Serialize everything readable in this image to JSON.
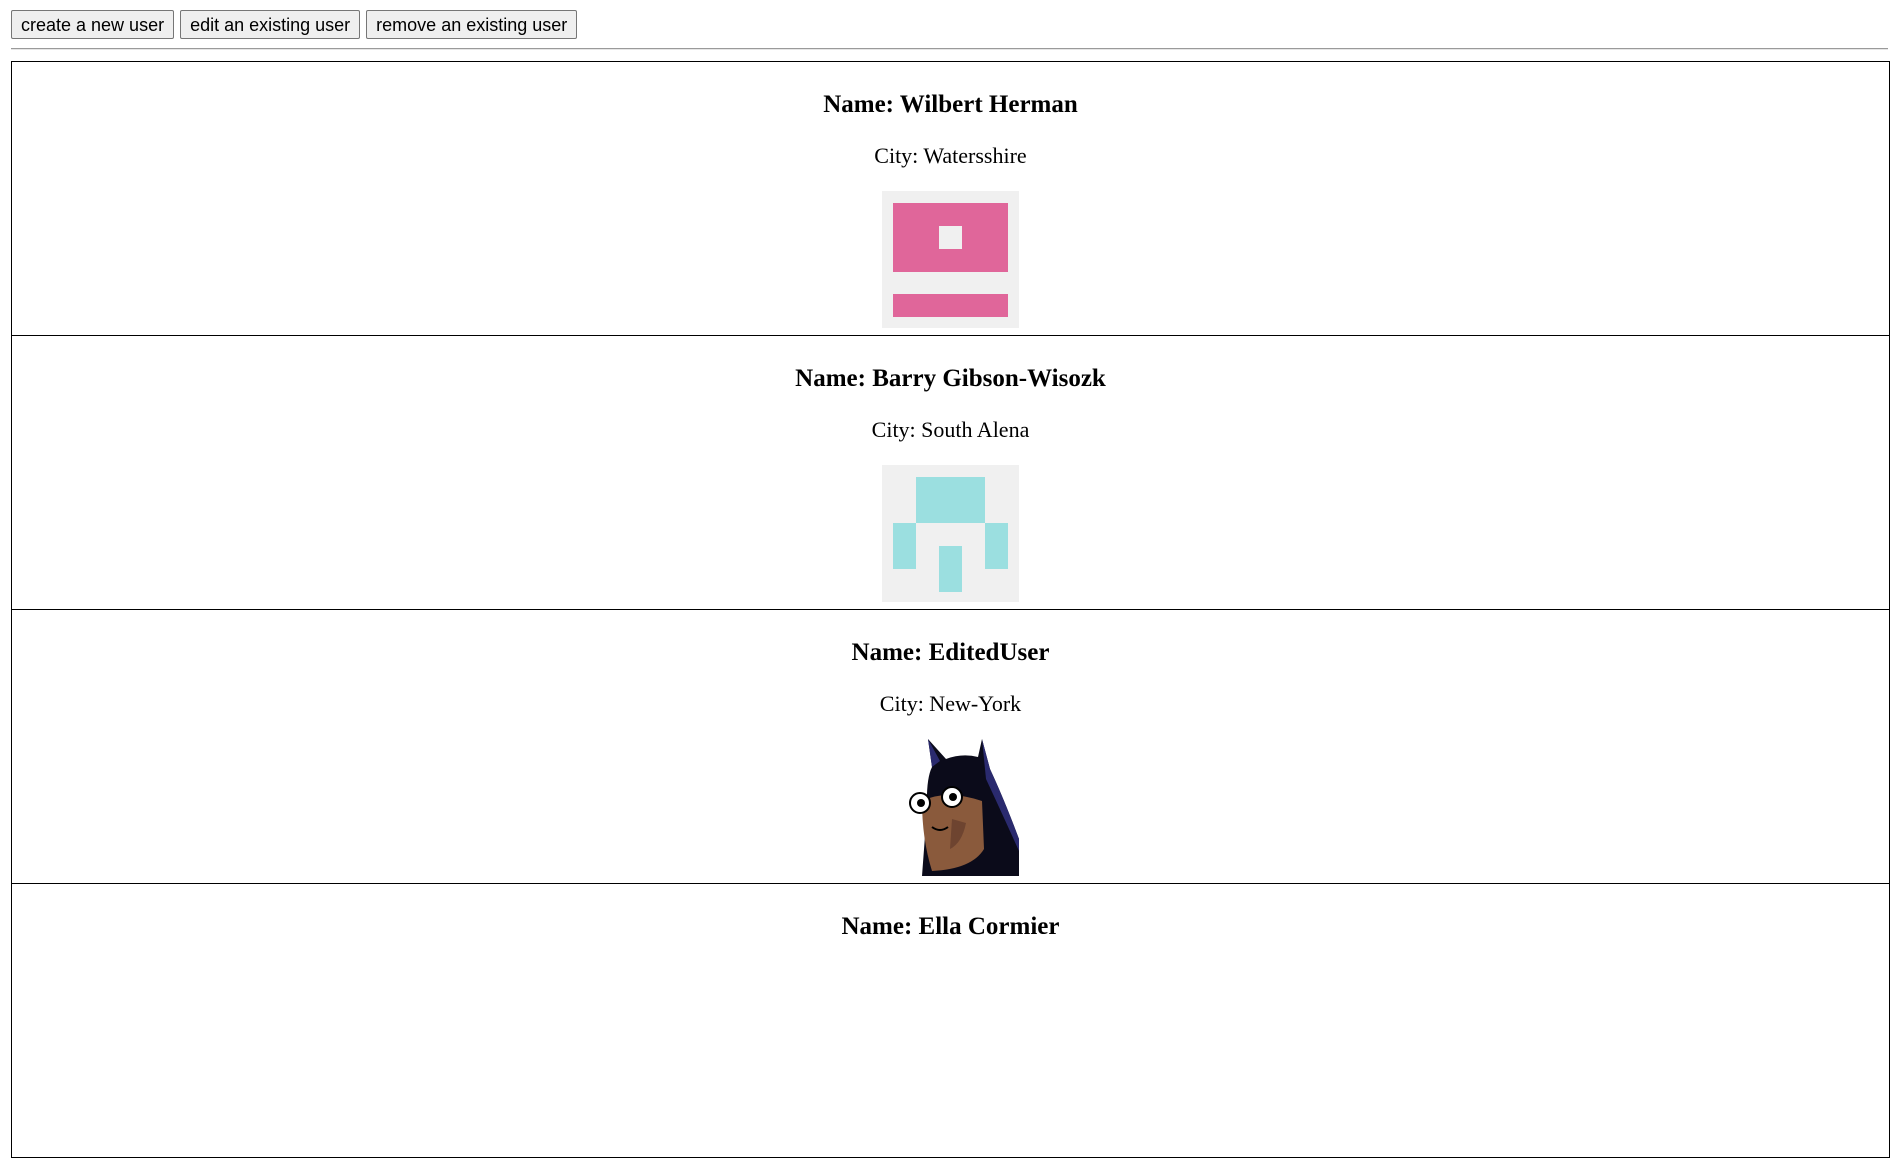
{
  "toolbar": {
    "create_label": "create a new user",
    "edit_label": "edit an existing user",
    "remove_label": "remove an existing user"
  },
  "users": [
    {
      "name": "Name: Wilbert Herman",
      "city": "City: Watersshire",
      "avatar": "identicon-pink",
      "color": "#e0669a"
    },
    {
      "name": "Name: Barry Gibson-Wisozk",
      "city": "City: South Alena",
      "avatar": "identicon-cyan",
      "color": "#9bdfe0"
    },
    {
      "name": "Name: EditedUser",
      "city": "City: New-York",
      "avatar": "batman-cartoon"
    },
    {
      "name": "Name: Ella Cormier",
      "city": "",
      "avatar": ""
    }
  ],
  "colors": {
    "identicon_bg": "#f0f0f0"
  }
}
